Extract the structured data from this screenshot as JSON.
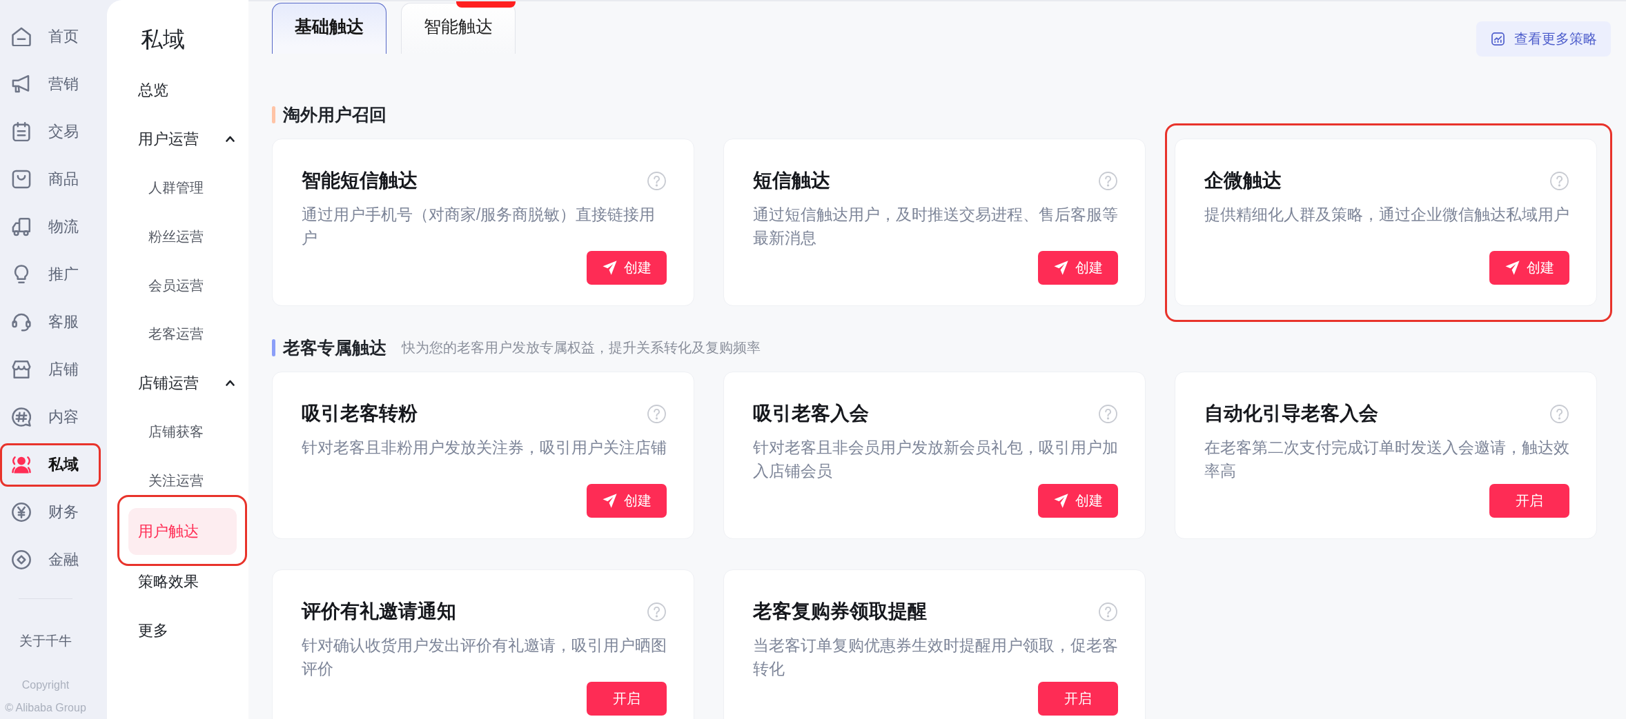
{
  "nav": {
    "items": [
      {
        "label": "首页",
        "selected": false,
        "highlighted": false
      },
      {
        "label": "营销",
        "selected": false,
        "highlighted": false
      },
      {
        "label": "交易",
        "selected": false,
        "highlighted": false
      },
      {
        "label": "商品",
        "selected": false,
        "highlighted": false
      },
      {
        "label": "物流",
        "selected": false,
        "highlighted": false
      },
      {
        "label": "推广",
        "selected": false,
        "highlighted": false
      },
      {
        "label": "客服",
        "selected": false,
        "highlighted": false
      },
      {
        "label": "店铺",
        "selected": false,
        "highlighted": false
      },
      {
        "label": "内容",
        "selected": false,
        "highlighted": false
      },
      {
        "label": "私域",
        "selected": true,
        "highlighted": true
      },
      {
        "label": "财务",
        "selected": false,
        "highlighted": false
      },
      {
        "label": "金融",
        "selected": false,
        "highlighted": false
      }
    ],
    "footer": {
      "about": "关于千牛",
      "copyright": "Copyright",
      "company": "© Alibaba Group"
    }
  },
  "sidebar": {
    "title": "私域",
    "items": [
      {
        "kind": "link",
        "label": "总览",
        "selected": false,
        "highlighted": false
      },
      {
        "kind": "group",
        "label": "用户运营",
        "expanded": true,
        "children": [
          {
            "label": "人群管理",
            "selected": false
          },
          {
            "label": "粉丝运营",
            "selected": false
          },
          {
            "label": "会员运营",
            "selected": false
          },
          {
            "label": "老客运营",
            "selected": false
          }
        ]
      },
      {
        "kind": "group",
        "label": "店铺运营",
        "expanded": true,
        "children": [
          {
            "label": "店铺获客",
            "selected": false
          },
          {
            "label": "关注运营",
            "selected": false
          }
        ]
      },
      {
        "kind": "link",
        "label": "用户触达",
        "selected": true,
        "highlighted": true
      },
      {
        "kind": "link",
        "label": "策略效果",
        "selected": false,
        "highlighted": false
      },
      {
        "kind": "link",
        "label": "更多",
        "selected": false,
        "highlighted": false
      }
    ]
  },
  "tabs": [
    {
      "label": "基础触达",
      "selected": true,
      "badge": false
    },
    {
      "label": "智能触达",
      "selected": false,
      "badge": true
    }
  ],
  "more_button": {
    "label": "查看更多策略"
  },
  "sections": [
    {
      "title": "淘外用户召回",
      "color": "#ffc4a6",
      "cards": [
        {
          "title": "智能短信触达",
          "description": "通过用户手机号（对商家/服务商脱敏）直接链接用户",
          "highlighted": false,
          "button": {
            "label": "创建",
            "kind": "send"
          }
        },
        {
          "title": "短信触达",
          "description": "通过短信触达用户，及时推送交易进程、售后客服等最新消息",
          "highlighted": false,
          "button": {
            "label": "创建",
            "kind": "send"
          }
        },
        {
          "title": "企微触达",
          "description": "提供精细化人群及策略，通过企业微信触达私域用户",
          "highlighted": true,
          "button": {
            "label": "创建",
            "kind": "send"
          }
        }
      ]
    },
    {
      "title": "老客专属触达",
      "subtitle": "快为您的老客用户发放专属权益，提升关系转化及复购频率",
      "color": "#8b9ef8",
      "cards": [
        {
          "title": "吸引老客转粉",
          "description": "针对老客且非粉用户发放关注券，吸引用户关注店铺",
          "highlighted": false,
          "button": {
            "label": "创建",
            "kind": "send"
          }
        },
        {
          "title": "吸引老客入会",
          "description": "针对老客且非会员用户发放新会员礼包，吸引用户加入店铺会员",
          "highlighted": false,
          "button": {
            "label": "创建",
            "kind": "send"
          }
        },
        {
          "title": "自动化引导老客入会",
          "description": "在老客第二次支付完成订单时发送入会邀请，触达效率高",
          "highlighted": false,
          "button": {
            "label": "开启",
            "kind": "plain"
          }
        },
        {
          "title": "评价有礼邀请通知",
          "description": "针对确认收货用户发出评价有礼邀请，吸引用户晒图评价",
          "highlighted": false,
          "button": {
            "label": "开启",
            "kind": "plain"
          }
        },
        {
          "title": "老客复购券领取提醒",
          "description": "当老客订单复购优惠券生效时提醒用户领取，促老客转化",
          "highlighted": false,
          "button": {
            "label": "开启",
            "kind": "plain"
          }
        }
      ]
    }
  ]
}
